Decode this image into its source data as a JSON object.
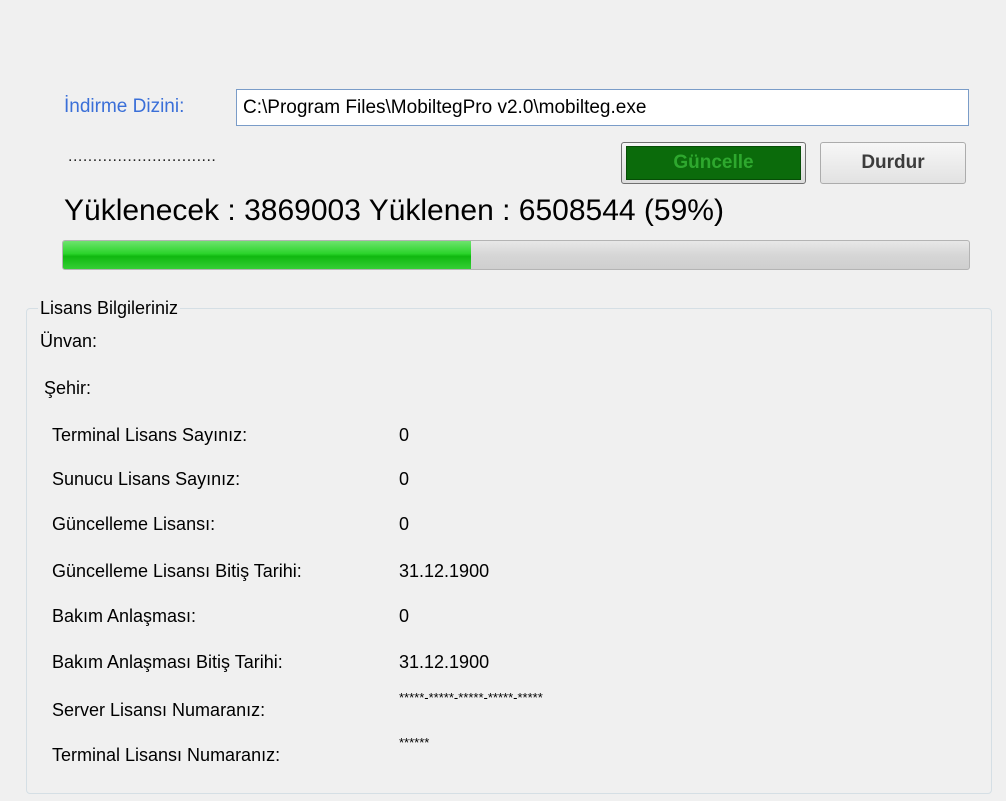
{
  "download": {
    "dir_label": "İndirme Dizini:",
    "dir_value": "C:\\Program Files\\MobiltegPro v2.0\\mobilteg.exe",
    "dots": "..............................",
    "update_button": "Güncelle",
    "stop_button": "Durdur",
    "status": "Yüklenecek : 3869003 Yüklenen : 6508544 (59%)",
    "progress_fraction": 0.45
  },
  "license": {
    "group_title": "Lisans Bilgileriniz",
    "title_label": "Ünvan:",
    "city_label": "Şehir:",
    "rows": [
      {
        "label": "Terminal Lisans Sayınız:",
        "value": "0"
      },
      {
        "label": "Sunucu Lisans Sayınız:",
        "value": "0"
      },
      {
        "label": "Güncelleme Lisansı:",
        "value": "0"
      },
      {
        "label": "Güncelleme Lisansı Bitiş Tarihi:",
        "value": "31.12.1900"
      },
      {
        "label": "Bakım Anlaşması:",
        "value": "0"
      },
      {
        "label": "Bakım Anlaşması Bitiş Tarihi:",
        "value": "31.12.1900"
      },
      {
        "label": "Server Lisansı Numaranız:",
        "value": "*****-*****-*****-*****-*****"
      },
      {
        "label": "Terminal Lisansı Numaranız:",
        "value": "******"
      }
    ]
  },
  "colors": {
    "label_blue": "#3a6fd8",
    "progress_green": "#2bd42b",
    "update_button_bg": "#0b6b0b"
  }
}
